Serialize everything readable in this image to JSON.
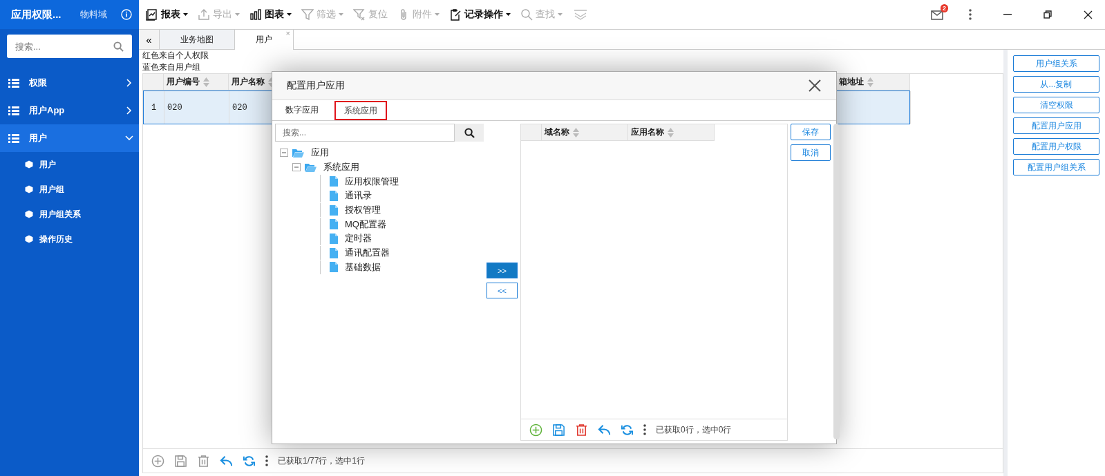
{
  "app": {
    "title": "应用权限...",
    "domain": "物料域"
  },
  "sidebar": {
    "search": {
      "placeholder": "搜索..."
    },
    "items": [
      {
        "label": "权限",
        "expanded": false,
        "selected": false
      },
      {
        "label": "用户App",
        "expanded": false,
        "selected": false
      },
      {
        "label": "用户",
        "expanded": true,
        "selected": true,
        "children": [
          {
            "label": "用户"
          },
          {
            "label": "用户组"
          },
          {
            "label": "用户组关系"
          },
          {
            "label": "操作历史"
          }
        ]
      }
    ]
  },
  "toolbar": {
    "items": [
      {
        "kind": "report",
        "label": "报表",
        "caret": true,
        "disabled": false
      },
      {
        "kind": "export",
        "label": "导出",
        "caret": true,
        "disabled": true
      },
      {
        "kind": "chart",
        "label": "图表",
        "caret": true,
        "disabled": false
      },
      {
        "kind": "filter",
        "label": "筛选",
        "caret": true,
        "disabled": true
      },
      {
        "kind": "reset",
        "label": "复位",
        "caret": false,
        "disabled": true
      },
      {
        "kind": "attach",
        "label": "附件",
        "caret": true,
        "disabled": true
      },
      {
        "kind": "record",
        "label": "记录操作",
        "caret": true,
        "disabled": false
      },
      {
        "kind": "search",
        "label": "查找",
        "caret": true,
        "disabled": true
      }
    ],
    "mail_badge": "2"
  },
  "tabs": {
    "collapse": "«",
    "items": [
      {
        "label": "业务地图",
        "selected": false
      },
      {
        "label": "用户",
        "selected": true,
        "close": "×"
      }
    ]
  },
  "notes": [
    "红色来自个人权限",
    "蓝色来自用户组"
  ],
  "grid": {
    "columns": [
      "用户编号",
      "用户名称",
      "箱地址"
    ],
    "rows": [
      {
        "number": "1",
        "cells": [
          "020",
          "020",
          ""
        ],
        "selected": true
      }
    ],
    "footer": {
      "tools": [
        {
          "kind": "add",
          "disabled": true
        },
        {
          "kind": "save",
          "disabled": true
        },
        {
          "kind": "delete",
          "disabled": true
        },
        {
          "kind": "undo",
          "disabled": false
        },
        {
          "kind": "refresh",
          "disabled": false
        }
      ],
      "status": "已获取1/77行，选中1行"
    }
  },
  "side_buttons": [
    "用户组关系",
    "从...复制",
    "清空权限",
    "配置用户应用",
    "配置用户权限",
    "配置用户组关系"
  ],
  "dialog": {
    "title": "配置用户应用",
    "tabs": [
      {
        "label": "数字应用",
        "selected": false,
        "highlighted": false
      },
      {
        "label": "系统应用",
        "selected": true,
        "highlighted": true
      }
    ],
    "search": {
      "placeholder": "搜索..."
    },
    "tree": [
      {
        "label": "应用",
        "expanded": true,
        "children": [
          {
            "label": "系统应用",
            "expanded": true,
            "children": [
              {
                "label": "应用权限管理"
              },
              {
                "label": "通讯录"
              },
              {
                "label": "授权管理"
              },
              {
                "label": "MQ配置器"
              },
              {
                "label": "定时器"
              },
              {
                "label": "通讯配置器"
              },
              {
                "label": "基础数据"
              }
            ]
          }
        ]
      }
    ],
    "move_buttons": [
      {
        "label": ">>",
        "selected": true
      },
      {
        "label": "<<",
        "selected": false
      }
    ],
    "grid": {
      "columns": [
        "域名称",
        "应用名称"
      ],
      "footer": {
        "tools": [
          {
            "kind": "add",
            "disabled": false
          },
          {
            "kind": "save",
            "disabled": false
          },
          {
            "kind": "delete",
            "disabled": false
          },
          {
            "kind": "undo",
            "disabled": false
          },
          {
            "kind": "refresh",
            "disabled": false
          }
        ],
        "status": "已获取0行，选中0行"
      }
    },
    "buttons": [
      "保存",
      "取消"
    ]
  }
}
